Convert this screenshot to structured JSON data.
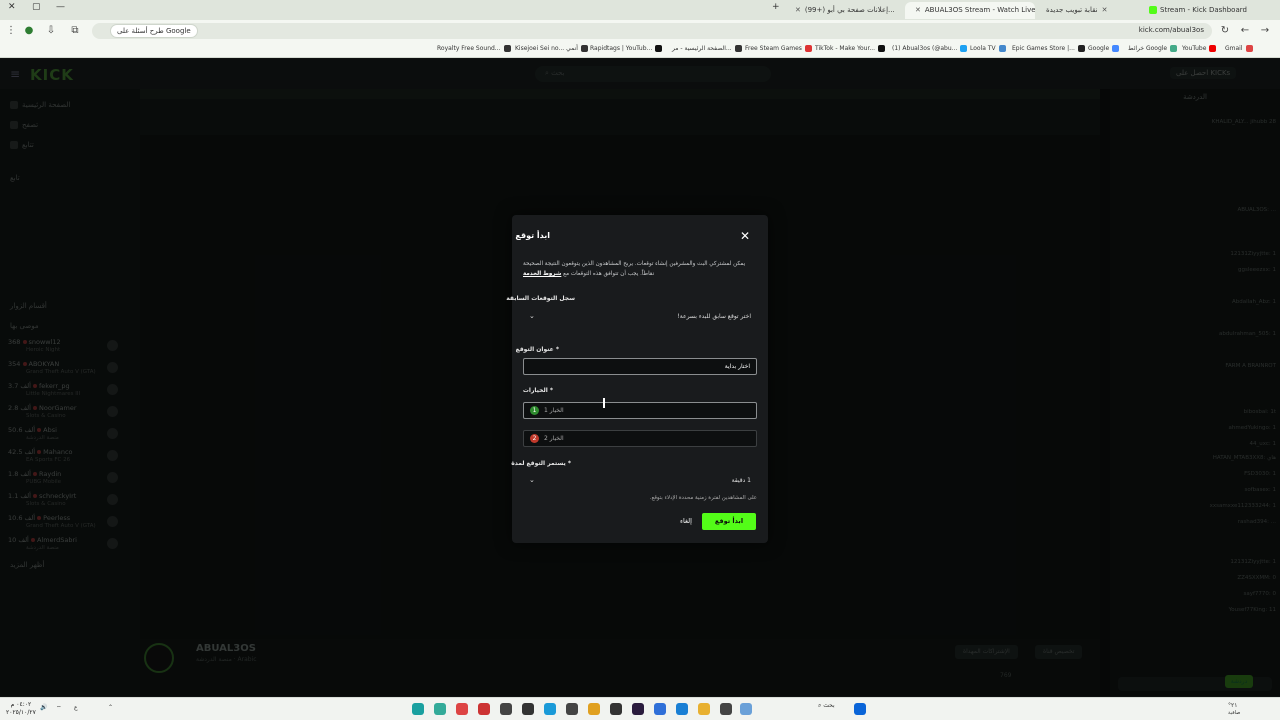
{
  "browser": {
    "tabs": [
      {
        "label": "Stream - Kick Dashboard",
        "active": false
      },
      {
        "label": "نقابة تبويب جديدة",
        "active": false
      },
      {
        "label": "ABUAL3OS Stream - Watch Live",
        "active": true
      },
      {
        "label": "(99+) إعلانات صفحة بي أبو...",
        "active": false
      }
    ],
    "url": "kick.com/abual3os",
    "search_chip": "طرح أسئلة على Google",
    "bookmarks": [
      "Gmail",
      "YouTube",
      "خرائط Google",
      "Google",
      "Epic Games Store |...",
      "Loola TV",
      "(1) Abual3os (@abu...",
      "TikTok - Make Your...",
      "Free Steam Games",
      "الصفحة الرئيسية - مر...",
      "Rapidtags | YouTub...",
      "Kisejoei Sei no... أنمي",
      "Royalty Free Sound..."
    ]
  },
  "site": {
    "logo": "KICK",
    "search_placeholder": "بحث",
    "get_kicks": "احصل على KICKs",
    "nav": [
      "الصفحة الرئيسية",
      "تصفح",
      "تتابع"
    ],
    "sections": [
      "تابع",
      "أقسام الزوار",
      "موصى بها"
    ],
    "channels": [
      {
        "name": "snowwl12",
        "count": "368",
        "sub": "Heroic Night"
      },
      {
        "name": "ABOKYAN",
        "count": "354",
        "sub": "Grand Theft Auto V (GTA)"
      },
      {
        "name": "fekerr_pg",
        "count": "ألف 3.7",
        "sub": "Little Nightmares III"
      },
      {
        "name": "NoorGamer",
        "count": "ألف 2.8",
        "sub": "Slots & Casino"
      },
      {
        "name": "Absi",
        "count": "ألف 50.6",
        "sub": "منصة الدردشة"
      },
      {
        "name": "Mahanco",
        "count": "ألف 42.5",
        "sub": "EA Sports FC 26"
      },
      {
        "name": "Raydin",
        "count": "ألف 1.8",
        "sub": "PUBG Mobile"
      },
      {
        "name": "schneckyIrt",
        "count": "ألف 1.1",
        "sub": "Slots & Casino"
      },
      {
        "name": "Peerless",
        "count": "ألف 10.6",
        "sub": "Grand Theft Auto V (GTA)"
      },
      {
        "name": "AlmerdSabri",
        "count": "ألف 10",
        "sub": "منصة الدردشة"
      }
    ],
    "show_more": "أظهر المزيد",
    "streamer": {
      "name": "ABUAL3OS",
      "sub": "منصة الدردشة",
      "lang": "Arabic",
      "viewers": "769"
    },
    "stream_buttons": [
      "الإشتراكات المهداة",
      "تخصيص قناة"
    ],
    "chat": {
      "title": "الدردشة",
      "messages": [
        "KHALID_ALY... jihubb 28",
        "ABUAL3OS: ...",
        "12131Ziyyjtte: 1",
        "ggsleeezxx: 1",
        "Abdallah_Abz: 1",
        "abdulrahman_505: 1",
        "FARM A BRAINROT",
        "bibosbai: 1t",
        "ahmedYukingo: 1",
        "44_uxc: 1",
        "HATAN_MTAB3XX8: هاي",
        "FSD3030: 1",
        "sofbasex: 1",
        "xxsamxxe112333244: 1",
        "rashad394: ...",
        "12131Ziyyjtte: 1",
        "ZZ4SXXMM: 0",
        "sayf7770: 0",
        "Yousef77King: 11"
      ],
      "send_label": "دردشة"
    }
  },
  "modal": {
    "title": "ابدأ توقع",
    "description": "يمكن لمشتركي البث والمشرفين إنشاء توقعات. يربح المشاهدون الذين يتوقعون النتيجة الصحيحة نقاطاً. يجب أن تتوافق هذه التوقعات مع",
    "terms_link": "شروط الخدمة",
    "history_label": "سجل التوقعات السابقة",
    "history_value": "اختر توقع سابق للبدء بسرعة!",
    "question_label": "* عنوان التوقع",
    "question_value": "اختار بداية",
    "options_label": "* الخيارات",
    "option1": "الخيار 1",
    "option2": "الخيار 2",
    "duration_label": "* يستمر التوقع لمدة",
    "duration_value": "1 دقيقة",
    "hint": "على المشاهدين لفترة زمنية محددة الإدلاء بتوقع.",
    "start_button": "ابدأ توقع",
    "cancel_button": "إلغاء",
    "colors": {
      "accent": "#53fc18",
      "option1": "#2e8b2e",
      "option2": "#c0392b"
    }
  },
  "taskbar": {
    "time": "٠٤:٠٢ م",
    "date": "٢٠٢٥/١٠/٢٧",
    "search": "بحث",
    "weather": "صافية",
    "weather_temp": "°٢١"
  }
}
